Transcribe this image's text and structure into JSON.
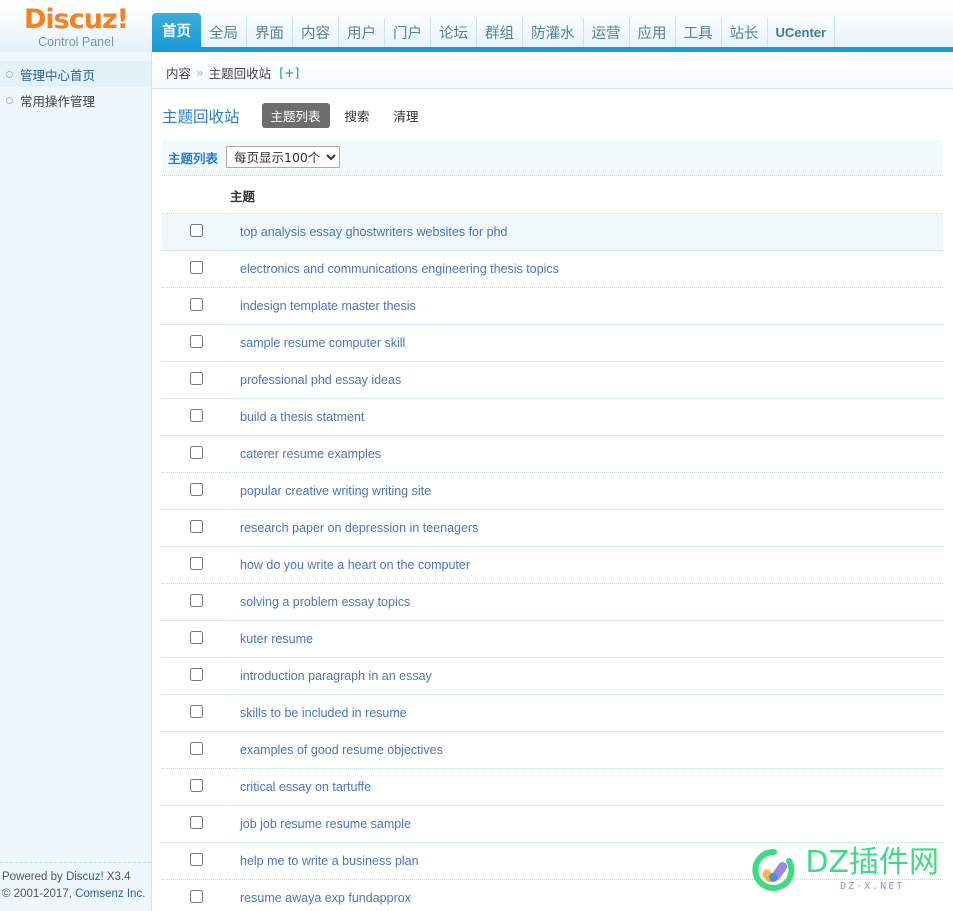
{
  "brand": {
    "title": "Discuz!",
    "subtitle": "Control Panel",
    "accent_color": "#F58220",
    "nav_color": "#1d9ad6"
  },
  "nav": {
    "items": [
      {
        "label": "首页",
        "active": true
      },
      {
        "label": "全局",
        "active": false
      },
      {
        "label": "界面",
        "active": false
      },
      {
        "label": "内容",
        "active": false
      },
      {
        "label": "用户",
        "active": false
      },
      {
        "label": "门户",
        "active": false
      },
      {
        "label": "论坛",
        "active": false
      },
      {
        "label": "群组",
        "active": false
      },
      {
        "label": "防灌水",
        "active": false
      },
      {
        "label": "运营",
        "active": false
      },
      {
        "label": "应用",
        "active": false
      },
      {
        "label": "工具",
        "active": false
      },
      {
        "label": "站长",
        "active": false
      },
      {
        "label": "UCenter",
        "active": false
      }
    ]
  },
  "breadcrumb": {
    "root": "内容",
    "separator": "»",
    "current": "主题回收站",
    "expand": "[+]"
  },
  "sidebar": {
    "items": [
      {
        "label": "管理中心首页",
        "active": true
      },
      {
        "label": "常用操作管理",
        "active": false
      }
    ],
    "footer_line1_prefix": "Powered by ",
    "footer_line1_link": "Discuz!",
    "footer_line1_suffix": " X3.4",
    "footer_line2_prefix": "© 2001-2017, ",
    "footer_line2_link": "Comsenz Inc."
  },
  "main": {
    "section_title": "主题回收站",
    "tabs": [
      {
        "label": "主题列表",
        "active": true
      },
      {
        "label": "搜索",
        "active": false
      },
      {
        "label": "清理",
        "active": false
      }
    ],
    "panel_title": "主题列表",
    "per_page_selected": "每页显示100个",
    "per_page_options": [
      "每页显示100个"
    ],
    "columns": {
      "checkbox": "",
      "subject": "主题"
    },
    "rows": [
      {
        "subject": "top analysis essay ghostwriters websites for phd",
        "checked": false,
        "alt": true
      },
      {
        "subject": "electronics and communications engineering thesis topics",
        "checked": false,
        "alt": false
      },
      {
        "subject": "indesign template master thesis",
        "checked": false,
        "alt": false
      },
      {
        "subject": "sample resume computer skill",
        "checked": false,
        "alt": false
      },
      {
        "subject": "professional phd essay ideas",
        "checked": false,
        "alt": false
      },
      {
        "subject": "build a thesis statment",
        "checked": false,
        "alt": false
      },
      {
        "subject": "caterer resume examples",
        "checked": false,
        "alt": false
      },
      {
        "subject": "popular creative writing writing site",
        "checked": false,
        "alt": false
      },
      {
        "subject": "research paper on depression in teenagers",
        "checked": false,
        "alt": false
      },
      {
        "subject": "how do you write a heart on the computer",
        "checked": false,
        "alt": false
      },
      {
        "subject": "solving a problem essay topics",
        "checked": false,
        "alt": false
      },
      {
        "subject": "kuter resume",
        "checked": false,
        "alt": false
      },
      {
        "subject": "introduction paragraph in an essay",
        "checked": false,
        "alt": false
      },
      {
        "subject": "skills to be included in resume",
        "checked": false,
        "alt": false
      },
      {
        "subject": "examples of good resume objectives",
        "checked": false,
        "alt": false
      },
      {
        "subject": "critical essay on tartuffe",
        "checked": false,
        "alt": false
      },
      {
        "subject": "job job resume resume sample",
        "checked": false,
        "alt": false
      },
      {
        "subject": "help me to write a business plan",
        "checked": false,
        "alt": false
      },
      {
        "subject": "resume awaya exp fundapprox",
        "checked": false,
        "alt": false
      }
    ]
  },
  "watermark": {
    "text": "DZ插件网",
    "sub": "DZ-X.NET",
    "color": "#3ddc84"
  }
}
